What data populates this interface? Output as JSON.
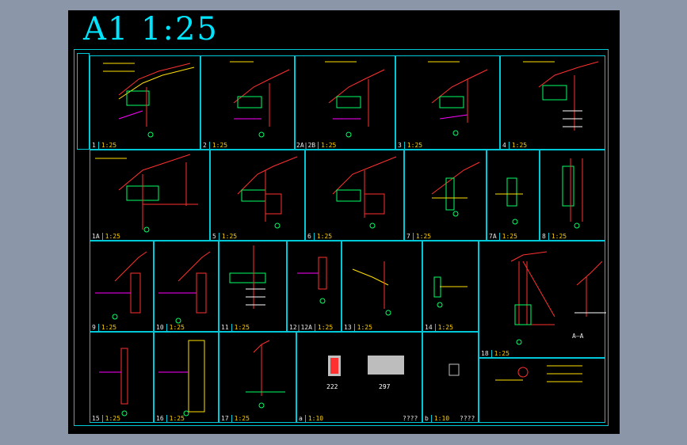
{
  "sheet": {
    "title": "A1  1:25"
  },
  "row1": [
    {
      "num": "1",
      "scale": "1:25"
    },
    {
      "num": "2",
      "scale": "1:25"
    },
    {
      "num": "2A|2B",
      "scale": "1:25"
    },
    {
      "num": "3",
      "scale": "1:25"
    },
    {
      "num": "4",
      "scale": "1:25"
    }
  ],
  "row2": [
    {
      "num": "1A",
      "scale": "1:25"
    },
    {
      "num": "5",
      "scale": "1:25"
    },
    {
      "num": "6",
      "scale": "1:25"
    },
    {
      "num": "7",
      "scale": "1:25"
    },
    {
      "num": "7A",
      "scale": "1:25"
    },
    {
      "num": "8",
      "scale": "1:25"
    }
  ],
  "row3": [
    {
      "num": "9",
      "scale": "1:25"
    },
    {
      "num": "10",
      "scale": "1:25"
    },
    {
      "num": "11",
      "scale": "1:25"
    },
    {
      "num": "12|12A",
      "scale": "1:25"
    },
    {
      "num": "13",
      "scale": "1:25"
    },
    {
      "num": "14",
      "scale": "1:25"
    }
  ],
  "row4": [
    {
      "num": "15",
      "scale": "1:25"
    },
    {
      "num": "16",
      "scale": "1:25"
    },
    {
      "num": "17",
      "scale": "1:25"
    },
    {
      "num": "a",
      "scale": "1:10"
    },
    {
      "num": "b",
      "scale": "1:10"
    }
  ],
  "detail18": {
    "num": "18",
    "scale": "1:25",
    "section_label": "A—A"
  },
  "thumbs": {
    "left": "222",
    "right": "297"
  },
  "cell_a_extra": "????",
  "cell_b_extra": "????"
}
